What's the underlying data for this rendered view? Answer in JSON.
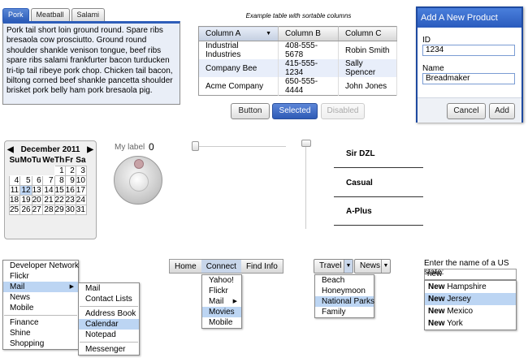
{
  "tabs": {
    "items": [
      "Pork",
      "Meatball",
      "Salami"
    ],
    "selected": 0,
    "content": "Pork tail short loin ground round. Spare ribs bresaola cow prosciutto. Ground round shoulder shankle venison tongue, beef ribs spare ribs salami frankfurter bacon turducken tri-tip tail ribeye pork chop. Chicken tail bacon, biltong corned beef shankle pancetta shoulder brisket pork belly ham pork bresaola pig."
  },
  "table": {
    "caption": "Example table with sortable columns",
    "columns": [
      "Column A",
      "Column B",
      "Column C"
    ],
    "rows": [
      [
        "Industrial Industries",
        "408-555-5678",
        "Robin Smith"
      ],
      [
        "Company Bee",
        "415-555-1234",
        "Sally Spencer"
      ],
      [
        "Acme Company",
        "650-555-4444",
        "John Jones"
      ]
    ]
  },
  "buttons": {
    "button": "Button",
    "selected": "Selected",
    "disabled": "Disabled"
  },
  "dialog": {
    "title": "Add A New Product",
    "id_label": "ID",
    "id_value": "1234",
    "name_label": "Name",
    "name_value": "Breadmaker",
    "cancel": "Cancel",
    "add": "Add"
  },
  "calendar": {
    "prev": "◀",
    "next": "▶",
    "month": "December 2011",
    "days": [
      "Su",
      "Mo",
      "Tu",
      "We",
      "Th",
      "Fr",
      "Sa"
    ],
    "weeks": [
      [
        "",
        "",
        "",
        "",
        "1",
        "2",
        "3"
      ],
      [
        "4",
        "5",
        "6",
        "7",
        "8",
        "9",
        "10"
      ],
      [
        "11",
        "12",
        "13",
        "14",
        "15",
        "16",
        "17"
      ],
      [
        "18",
        "19",
        "20",
        "21",
        "22",
        "23",
        "24"
      ],
      [
        "25",
        "26",
        "27",
        "28",
        "29",
        "30",
        "31"
      ]
    ],
    "selected_day": "12"
  },
  "knob": {
    "label": "My label",
    "value": "0"
  },
  "stack": [
    "Sir DZL",
    "Casual",
    "A-Plus"
  ],
  "menu1": {
    "items": [
      "Developer Network",
      "Flickr",
      "Mail",
      "News",
      "Mobile",
      "Finance",
      "Shine",
      "Shopping"
    ],
    "highlighted": "Mail",
    "submenu": [
      "Mail",
      "Contact Lists",
      "Address Book",
      "Calendar",
      "Notepad",
      "Messenger"
    ],
    "submenu_highlighted": "Calendar"
  },
  "menubar": {
    "items": [
      "Home",
      "Connect",
      "Find Info"
    ],
    "highlighted": "Connect",
    "dropdown": [
      "Yahoo!",
      "Flickr",
      "Mail",
      "Movies",
      "Mobile"
    ],
    "dropdown_highlighted": "Movies"
  },
  "splitmenus": {
    "items": [
      "Travel",
      "News"
    ],
    "arrow": "▼",
    "dropdown": [
      "Beach",
      "Honeymoon",
      "National Parks",
      "Family"
    ],
    "dropdown_highlighted": "National Parks"
  },
  "suggest": {
    "label": "Enter the name of a US state:",
    "value": "new",
    "prefix": "New",
    "suffixes": [
      " Hampshire",
      " Jersey",
      " Mexico",
      " York"
    ],
    "highlighted": 1
  }
}
